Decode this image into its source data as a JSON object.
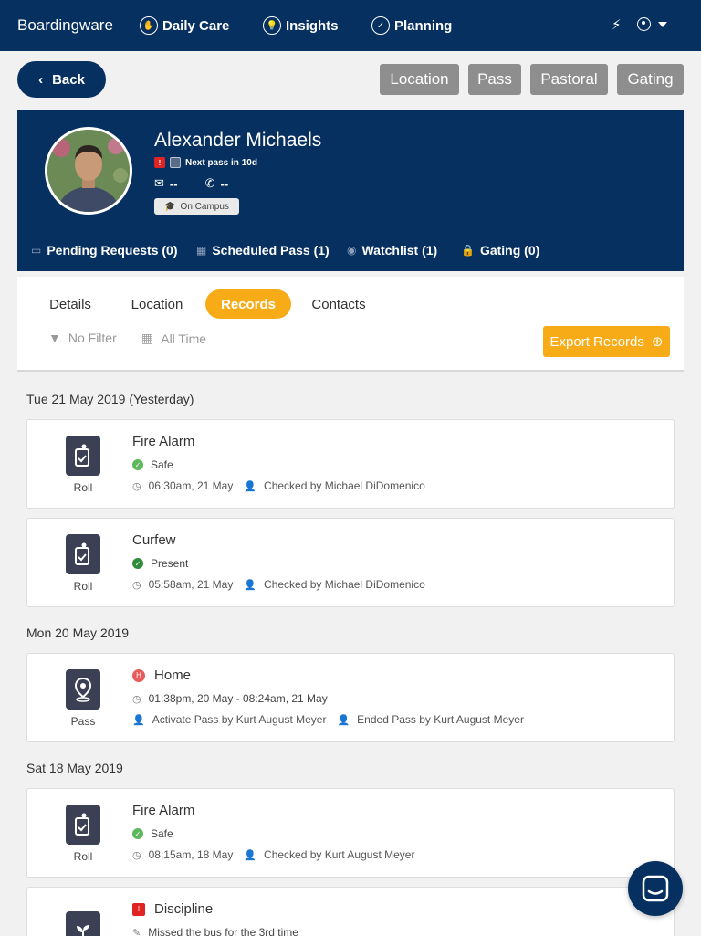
{
  "nav": {
    "brand": "Boardingware",
    "items": [
      {
        "label": "Daily Care",
        "icon": "hand-icon"
      },
      {
        "label": "Insights",
        "icon": "bulb-icon"
      },
      {
        "label": "Planning",
        "icon": "calendar-check-icon"
      }
    ],
    "bolt_icon": "bolt-icon",
    "user_icon": "user-icon"
  },
  "actions": {
    "back_label": "Back",
    "buttons": [
      "Location",
      "Pass",
      "Pastoral",
      "Gating"
    ]
  },
  "profile": {
    "name": "Alexander Michaels",
    "next_pass": "Next pass in 10d",
    "email": "--",
    "phone": "--",
    "status": "On Campus",
    "stats": [
      {
        "label": "Pending Requests (0)",
        "icon": "inbox-icon"
      },
      {
        "label": "Scheduled Pass (1)",
        "icon": "calendar-icon"
      },
      {
        "label": "Watchlist (1)",
        "icon": "eye-icon"
      },
      {
        "label": "Gating (0)",
        "icon": "lock-icon"
      }
    ]
  },
  "tabs": [
    "Details",
    "Location",
    "Records",
    "Contacts"
  ],
  "active_tab": "Records",
  "filters": {
    "filter": "No Filter",
    "time": "All Time"
  },
  "export_label": "Export Records",
  "groups": [
    {
      "date": "Tue 21 May 2019 (Yesterday)",
      "records": [
        {
          "type": "Roll",
          "title": "Fire Alarm",
          "status": "Safe",
          "time": "06:30am, 21 May",
          "by": "Checked by Michael DiDomenico"
        },
        {
          "type": "Roll",
          "title": "Curfew",
          "status": "Present",
          "time": "05:58am, 21 May",
          "by": "Checked by Michael DiDomenico"
        }
      ]
    },
    {
      "date": "Mon 20 May 2019",
      "records": [
        {
          "type": "Pass",
          "badge": "H",
          "title": "Home",
          "time": "01:38pm, 20 May - 08:24am, 21 May",
          "by": "Activate Pass by Kurt August Meyer",
          "by2": "Ended Pass by Kurt August Meyer"
        }
      ]
    },
    {
      "date": "Sat 18 May 2019",
      "records": [
        {
          "type": "Roll",
          "title": "Fire Alarm",
          "status": "Safe",
          "time": "08:15am, 18 May",
          "by": "Checked by Kurt August Meyer"
        },
        {
          "type": "Pastoral",
          "title": "Discipline",
          "note": "Missed the bus for the 3rd time"
        }
      ]
    }
  ],
  "colors": {
    "navy": "#06305f",
    "accent": "#f7ab16",
    "safe": "#5cb85c",
    "present": "#2e8b3a",
    "alert": "#e02424"
  }
}
